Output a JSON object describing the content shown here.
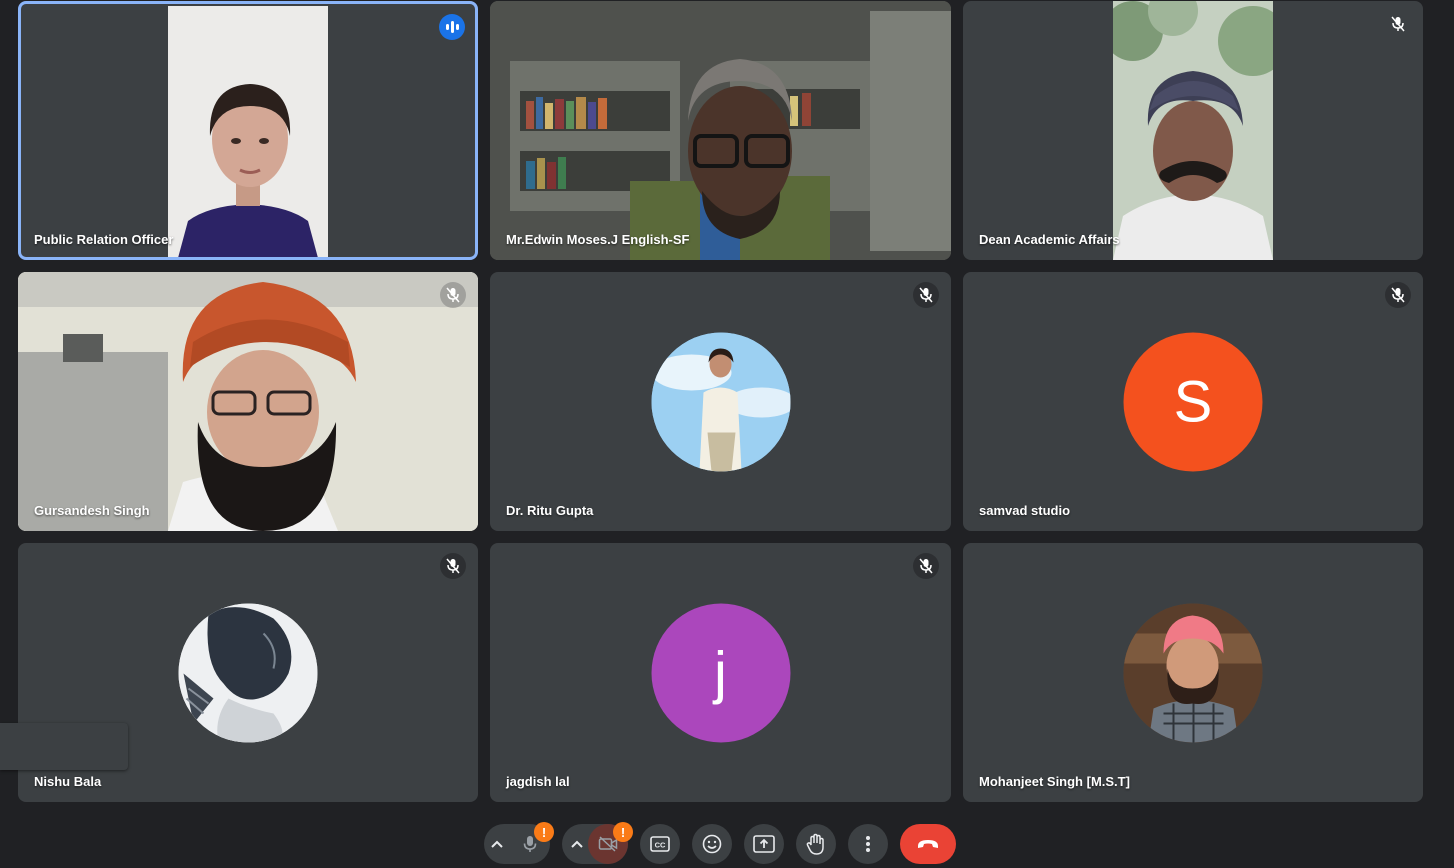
{
  "participants": [
    {
      "name": "Public Relation Officer",
      "speaking": true
    },
    {
      "name": "Mr.Edwin Moses.J English-SF"
    },
    {
      "name": "Dean Academic Affairs",
      "muted": true
    },
    {
      "name": "Gursandesh Singh",
      "muted": true
    },
    {
      "name": "Dr. Ritu Gupta",
      "muted": true
    },
    {
      "name": "samvad studio",
      "muted": true,
      "initial": "S",
      "color": "#f4511e"
    },
    {
      "name": "Nishu Bala",
      "muted": true
    },
    {
      "name": "jagdish lal",
      "muted": true,
      "initial": "j",
      "color": "#ab47bc"
    },
    {
      "name": "Mohanjeet Singh [M.S.T]"
    }
  ],
  "toolbar": {
    "mic_badge": "!",
    "camera_badge": "!",
    "cc_label": "CC",
    "end_call_color": "#ea4335",
    "buttons": [
      "mic-icon",
      "camera-off-icon",
      "captions-icon",
      "emoji-icon",
      "present-icon",
      "raise-hand-icon",
      "more-icon",
      "end-call-icon"
    ]
  },
  "colors": {
    "background": "#202124",
    "tile": "#3c4043",
    "active_border": "#8ab4f8",
    "badge": "#fa7b17"
  }
}
